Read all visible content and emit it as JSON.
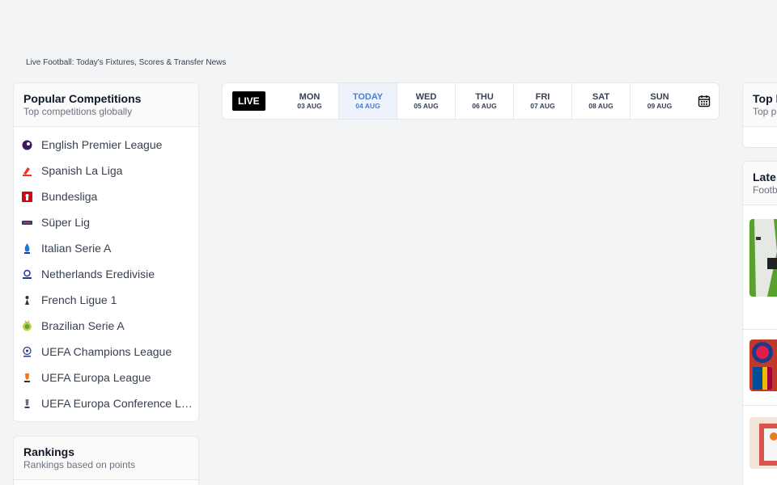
{
  "page": {
    "subtitle": "Live Football: Today's Fixtures, Scores & Transfer News"
  },
  "popular": {
    "title": "Popular Competitions",
    "subtitle": "Top competitions globally",
    "items": [
      {
        "label": "English Premier League",
        "icon": "premier-league-icon"
      },
      {
        "label": "Spanish La Liga",
        "icon": "laliga-icon"
      },
      {
        "label": "Bundesliga",
        "icon": "bundesliga-icon"
      },
      {
        "label": "Süper Lig",
        "icon": "super-lig-icon"
      },
      {
        "label": "Italian Serie A",
        "icon": "serie-a-icon"
      },
      {
        "label": "Netherlands Eredivisie",
        "icon": "eredivisie-icon"
      },
      {
        "label": "French Ligue 1",
        "icon": "ligue-1-icon"
      },
      {
        "label": "Brazilian Serie A",
        "icon": "brasileirao-icon"
      },
      {
        "label": "UEFA Champions League",
        "icon": "champions-league-icon"
      },
      {
        "label": "UEFA Europa League",
        "icon": "europa-league-icon"
      },
      {
        "label": "UEFA Europa Conference League",
        "icon": "conference-league-icon"
      }
    ]
  },
  "rankings": {
    "title": "Rankings",
    "subtitle": "Rankings based on points"
  },
  "datebar": {
    "live_label": "LIVE",
    "days": [
      {
        "name": "MON",
        "date": "03 AUG",
        "active": false
      },
      {
        "name": "TODAY",
        "date": "04 AUG",
        "active": true
      },
      {
        "name": "WED",
        "date": "05 AUG",
        "active": false
      },
      {
        "name": "THU",
        "date": "06 AUG",
        "active": false
      },
      {
        "name": "FRI",
        "date": "07 AUG",
        "active": false
      },
      {
        "name": "SAT",
        "date": "08 AUG",
        "active": false
      },
      {
        "name": "SUN",
        "date": "09 AUG",
        "active": false
      }
    ],
    "calendar_icon": "calendar-icon"
  },
  "top_panel": {
    "title": "Top l",
    "subtitle": "Top p"
  },
  "latest": {
    "title": "Late",
    "subtitle": "Footb"
  },
  "colors": {
    "background": "#f3f4f6",
    "active_day": "#4a7fd1",
    "active_day_bg": "#eef3fb",
    "live_bg": "#000000"
  }
}
